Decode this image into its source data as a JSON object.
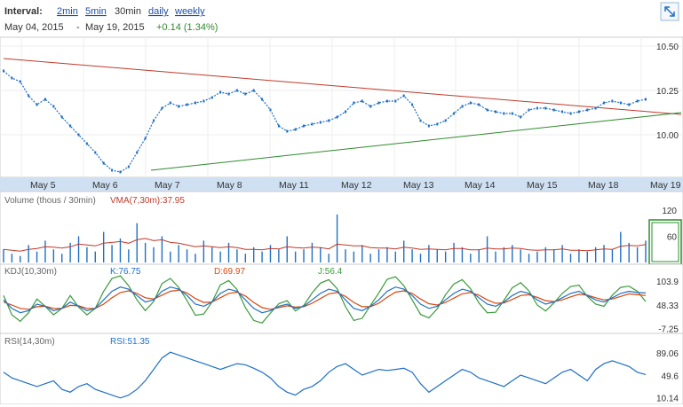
{
  "toolbar": {
    "interval_label": "Interval:",
    "intervals": [
      {
        "label": "2min",
        "active": false
      },
      {
        "label": "5min",
        "active": false
      },
      {
        "label": "30min",
        "active": true
      },
      {
        "label": "daily",
        "active": false
      },
      {
        "label": "weekly",
        "active": false
      }
    ]
  },
  "range": {
    "start": "May 04, 2015",
    "separator": "-",
    "end": "May 19, 2015",
    "change": "+0.14 (1.34%)"
  },
  "icons": {
    "expand": "expand-arrows-icon"
  },
  "colors": {
    "price": "#1f6fc5",
    "trend_red": "#c0392b",
    "trend_green": "#2e8b2e",
    "vma": "#c0392b",
    "k": "#1f6fc5",
    "d": "#d9480f",
    "j": "#3a9a3a",
    "axis_band": "#cfe0f2",
    "highlight": "#2e8b2e"
  },
  "chart_data": [
    {
      "type": "line",
      "name": "price",
      "x": [
        "May 5",
        "May 6",
        "May 7",
        "May 8",
        "May 11",
        "May 12",
        "May 13",
        "May 14",
        "May 15",
        "May 18",
        "May 19"
      ],
      "y_ticks": [
        "10.50",
        "10.25",
        "10.00"
      ],
      "ylim": [
        9.78,
        10.53
      ],
      "values": [
        10.36,
        10.32,
        10.3,
        10.22,
        10.17,
        10.2,
        10.16,
        10.1,
        10.05,
        10.0,
        9.95,
        9.9,
        9.84,
        9.8,
        9.79,
        9.82,
        9.9,
        9.98,
        10.08,
        10.15,
        10.18,
        10.16,
        10.17,
        10.18,
        10.19,
        10.21,
        10.24,
        10.23,
        10.25,
        10.23,
        10.25,
        10.2,
        10.14,
        10.05,
        10.02,
        10.03,
        10.05,
        10.06,
        10.07,
        10.08,
        10.1,
        10.13,
        10.18,
        10.19,
        10.16,
        10.18,
        10.19,
        10.19,
        10.22,
        10.17,
        10.08,
        10.05,
        10.06,
        10.08,
        10.12,
        10.16,
        10.18,
        10.17,
        10.14,
        10.13,
        10.12,
        10.12,
        10.1,
        10.14,
        10.15,
        10.15,
        10.14,
        10.13,
        10.12,
        10.13,
        10.14,
        10.15,
        10.18,
        10.19,
        10.18,
        10.17,
        10.19,
        10.2
      ],
      "trendlines": [
        {
          "color": "red",
          "points": [
            [
              "May 4",
              10.43
            ],
            [
              "May 19",
              10.11
            ]
          ]
        },
        {
          "color": "green",
          "points": [
            [
              "May 7",
              9.8
            ],
            [
              "May 19",
              10.12
            ]
          ]
        }
      ]
    },
    {
      "type": "bar",
      "name": "volume",
      "title": "Volume (thous / 30min)",
      "indicator": "VMA(7,30m):37.95",
      "y_ticks": [
        "120",
        "60"
      ],
      "ylim": [
        0,
        130
      ],
      "values": [
        30,
        20,
        15,
        40,
        25,
        50,
        30,
        20,
        45,
        60,
        35,
        25,
        70,
        40,
        55,
        30,
        90,
        45,
        35,
        60,
        25,
        40,
        30,
        20,
        50,
        35,
        25,
        45,
        30,
        20,
        35,
        25,
        40,
        30,
        60,
        25,
        30,
        45,
        35,
        20,
        110,
        30,
        25,
        40,
        20,
        30,
        35,
        25,
        50,
        30,
        20,
        40,
        30,
        25,
        45,
        35,
        20,
        30,
        60,
        25,
        35,
        40,
        30,
        20,
        25,
        35,
        30,
        40,
        20,
        30,
        25,
        35,
        40,
        30,
        70,
        45,
        35,
        50
      ],
      "vma": [
        30,
        28,
        26,
        30,
        32,
        36,
        35,
        33,
        36,
        42,
        40,
        38,
        44,
        46,
        48,
        44,
        52,
        55,
        50,
        52,
        46,
        44,
        40,
        36,
        38,
        36,
        34,
        36,
        34,
        30,
        30,
        29,
        32,
        31,
        36,
        34,
        33,
        35,
        34,
        31,
        42,
        40,
        38,
        38,
        34,
        33,
        33,
        31,
        35,
        33,
        30,
        31,
        30,
        29,
        32,
        32,
        29,
        29,
        33,
        31,
        31,
        33,
        32,
        29,
        28,
        29,
        29,
        31,
        28,
        28,
        27,
        29,
        31,
        30,
        37,
        39,
        38,
        41
      ]
    },
    {
      "type": "line",
      "name": "kdj",
      "title": "KDJ(10,30m)",
      "labels": {
        "k": "K:76.75",
        "d": "D:69.97",
        "j": "J:56.4"
      },
      "y_ticks": [
        "103.9",
        "48.33",
        "-7.25"
      ],
      "ylim": [
        -10,
        110
      ],
      "k": [
        60,
        40,
        30,
        35,
        50,
        45,
        35,
        40,
        55,
        45,
        35,
        40,
        60,
        80,
        90,
        85,
        70,
        55,
        60,
        80,
        90,
        85,
        70,
        50,
        45,
        55,
        75,
        85,
        80,
        60,
        40,
        30,
        35,
        45,
        50,
        40,
        45,
        60,
        75,
        85,
        80,
        60,
        40,
        35,
        45,
        60,
        80,
        90,
        85,
        70,
        50,
        40,
        45,
        60,
        75,
        85,
        80,
        65,
        50,
        45,
        55,
        70,
        80,
        75,
        60,
        50,
        55,
        65,
        75,
        80,
        70,
        60,
        55,
        65,
        75,
        80,
        77,
        76
      ],
      "d": [
        55,
        48,
        40,
        38,
        44,
        45,
        40,
        40,
        47,
        46,
        40,
        40,
        50,
        65,
        77,
        81,
        75,
        65,
        62,
        71,
        80,
        83,
        76,
        63,
        54,
        55,
        65,
        75,
        78,
        69,
        54,
        42,
        38,
        42,
        46,
        43,
        44,
        52,
        63,
        74,
        77,
        68,
        54,
        44,
        44,
        52,
        66,
        78,
        81,
        75,
        62,
        51,
        48,
        54,
        64,
        74,
        77,
        71,
        60,
        52,
        53,
        61,
        70,
        72,
        66,
        58,
        56,
        60,
        67,
        73,
        71,
        65,
        60,
        62,
        68,
        74,
        72,
        70
      ],
      "j": [
        70,
        25,
        10,
        30,
        62,
        45,
        25,
        40,
        70,
        43,
        25,
        40,
        80,
        110,
        116,
        93,
        60,
        35,
        56,
        98,
        110,
        89,
        58,
        24,
        27,
        55,
        95,
        105,
        84,
        42,
        12,
        6,
        29,
        51,
        58,
        34,
        47,
        76,
        99,
        107,
        86,
        44,
        12,
        17,
        47,
        76,
        108,
        114,
        93,
        60,
        26,
        18,
        39,
        72,
        97,
        107,
        86,
        53,
        30,
        31,
        59,
        88,
        100,
        81,
        48,
        34,
        53,
        75,
        91,
        94,
        68,
        50,
        45,
        71,
        89,
        92,
        80,
        56
      ]
    },
    {
      "type": "line",
      "name": "rsi",
      "title": "RSI(14,30m)",
      "label": "RSI:51.35",
      "y_ticks": [
        "89.06",
        "49.6",
        "10.14"
      ],
      "ylim": [
        5,
        95
      ],
      "values": [
        55,
        45,
        40,
        35,
        30,
        35,
        40,
        25,
        20,
        30,
        35,
        25,
        20,
        15,
        10,
        15,
        25,
        40,
        60,
        80,
        90,
        85,
        80,
        75,
        70,
        65,
        60,
        65,
        70,
        68,
        62,
        55,
        45,
        30,
        20,
        15,
        25,
        30,
        40,
        55,
        65,
        70,
        60,
        50,
        55,
        60,
        58,
        60,
        62,
        55,
        35,
        20,
        30,
        40,
        50,
        60,
        55,
        45,
        40,
        35,
        30,
        40,
        50,
        45,
        40,
        35,
        45,
        55,
        60,
        50,
        40,
        60,
        70,
        75,
        70,
        65,
        55,
        51
      ]
    }
  ]
}
